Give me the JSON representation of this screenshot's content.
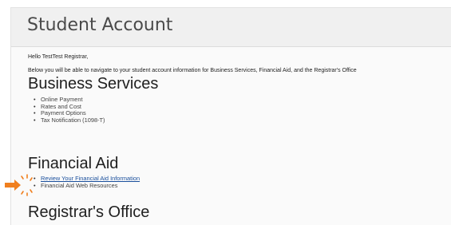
{
  "page": {
    "title": "Student Account"
  },
  "greeting": "Hello TestTest Registrar,",
  "intro": "Below you will be able to navigate to your student account information for Business Services, Financial Aid, and the Registrar's Office",
  "sections": [
    {
      "heading": "Business Services",
      "items": [
        "Online Payment",
        "Rates and Cost",
        "Payment Options",
        "Tax Notification (1098-T)"
      ]
    },
    {
      "heading": "Financial Aid",
      "items": [
        "Review Your Financial Aid Information",
        "Financial Aid Web Resources"
      ]
    },
    {
      "heading": "Registrar's Office",
      "items": []
    }
  ],
  "pointer": {
    "icon": "arrow-pointer-icon",
    "color": "#f07f1e"
  },
  "colors": {
    "link": "#1a4f9c",
    "title_bar": "#f0f0f0"
  }
}
